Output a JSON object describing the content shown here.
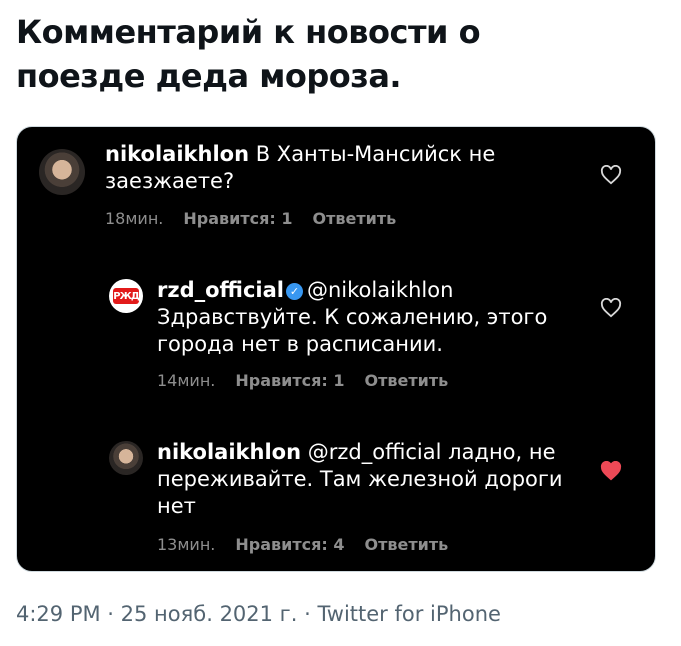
{
  "tweet": {
    "text_line1": "Комментарий к новости о",
    "text_line2": "поезде деда мороза."
  },
  "comments": [
    {
      "username": "nikolaikhlon",
      "text_a": " В Ханты-Мансийск не",
      "text_b": "заезжаете?",
      "time": "18мин.",
      "likes": "Нравится: 1",
      "reply": "Ответить",
      "liked": false
    },
    {
      "username": "rzd_official",
      "mention": "@nikolaikhlon",
      "text_a": "Здравствуйте. К сожалению, этого",
      "text_b": "города нет в расписании.",
      "time": "14мин.",
      "likes": "Нравится: 1",
      "reply": "Ответить",
      "liked": false,
      "avatar_logo_text": "РЖД"
    },
    {
      "username": "nikolaikhlon",
      "mention": "@rzd_official",
      "text_a": " ладно, не",
      "text_b": "переживайте. Там железной дороги",
      "text_c": "нет",
      "time": "13мин.",
      "likes": "Нравится: 4",
      "reply": "Ответить",
      "liked": true
    }
  ],
  "footer": {
    "time": "4:29 PM",
    "sep1": " · ",
    "date": "25 нояб. 2021 г.",
    "sep2": " · ",
    "source": "Twitter for iPhone"
  },
  "colors": {
    "embed_bg": "#000000",
    "heart_liked": "#ed4956",
    "verified": "#3897f0",
    "meta_gray": "#8e8e8e"
  }
}
